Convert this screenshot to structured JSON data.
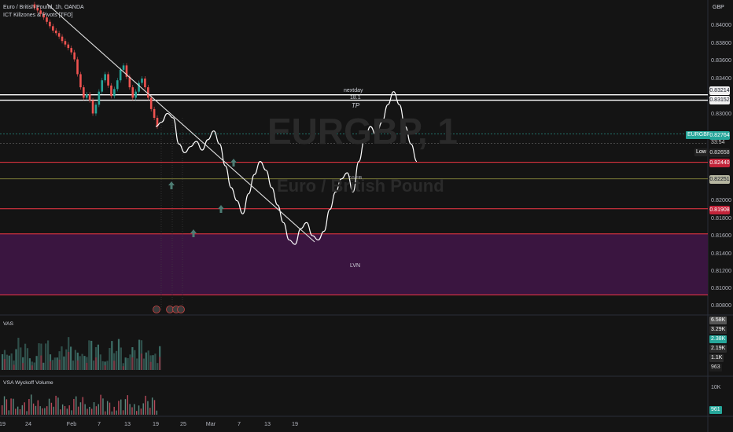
{
  "header": {
    "symbol_line": "Euro / British Pound, 1h, OANDA",
    "indicator_line": "ICT Killzones & Pivots [TFO]"
  },
  "axis": {
    "currency": "GBP",
    "y_ticks": [
      "0.84000",
      "0.83800",
      "0.83600",
      "0.83400",
      "0.83000",
      "0.82000",
      "0.81800",
      "0.81600",
      "0.81400",
      "0.81200",
      "0.81000",
      "0.80800"
    ],
    "x_ticks": [
      "19",
      "24",
      "Feb",
      "7",
      "13",
      "19",
      "25",
      "Mar",
      "7",
      "13",
      "19"
    ]
  },
  "price_labels": {
    "upper1": "0.83214",
    "upper2": "0.83152",
    "symbol": "EURGBP",
    "current": "0.82764",
    "countdown": "33:54",
    "low_label": "Low",
    "low_value": "0.82658",
    "red1": "0.82440",
    "olive": "0.82251",
    "red2": "0.81908"
  },
  "chart_labels": {
    "tp_top": "nextday",
    "tp_mid": "18.1",
    "tp": "TP",
    "fib": "0.5 FIB",
    "lvn": "LVN"
  },
  "watermark": {
    "symbol": "EURGBP, 1",
    "name": "Euro / British Pound"
  },
  "vas": {
    "title": "VAS",
    "badges": [
      "6.58K",
      "3.29K",
      "2.38K",
      "2.19K",
      "1.1K",
      "963"
    ]
  },
  "wyckoff": {
    "title": "VSA Wyckoff Volume",
    "scale": "10K",
    "badge": "961"
  },
  "colors": {
    "background": "#141414",
    "red_level": "#f23645",
    "purple_zone": "#3a1540",
    "white_line": "#ffffff",
    "olive_line": "#8a8a3c",
    "teal_arrow": "#4d7d74",
    "teal_badge": "#26a69a"
  },
  "chart_data": {
    "type": "line",
    "title": "Euro / British Pound, 1h, OANDA",
    "ylabel": "GBP",
    "ylim": [
      0.807,
      0.843
    ],
    "levels": [
      {
        "name": "upper1",
        "value": 0.83214
      },
      {
        "name": "upper2",
        "value": 0.83152
      },
      {
        "name": "current",
        "value": 0.82764
      },
      {
        "name": "low",
        "value": 0.82658
      },
      {
        "name": "red1",
        "value": 0.8244
      },
      {
        "name": "olive",
        "value": 0.82251
      },
      {
        "name": "red2",
        "value": 0.81908
      }
    ],
    "zone": [
      0.8092,
      0.8162
    ],
    "series": [
      {
        "values": [
          0.8425,
          0.8421,
          0.8418,
          0.8414,
          0.841,
          0.8405,
          0.84,
          0.8395,
          0.8392,
          0.8388,
          0.8383,
          0.8379,
          0.8375,
          0.837,
          0.8362,
          0.8345,
          0.833,
          0.8318,
          0.8322,
          0.8315,
          0.83,
          0.831,
          0.8325,
          0.8338,
          0.8345,
          0.8332,
          0.832,
          0.8328,
          0.8338,
          0.835,
          0.8355,
          0.8342,
          0.833,
          0.8318,
          0.8325,
          0.8335,
          0.834,
          0.833,
          0.8318,
          0.8305,
          0.8295,
          0.8285
        ]
      },
      {
        "values": [
          0.8285,
          0.829,
          0.83,
          0.8295,
          0.8265,
          0.8255,
          0.8262,
          0.8268,
          0.8258,
          0.827,
          0.828,
          0.8265,
          0.824,
          0.8215,
          0.82,
          0.8185,
          0.8208,
          0.823,
          0.8245,
          0.8235,
          0.8215,
          0.8195,
          0.8175,
          0.8155,
          0.815,
          0.8168,
          0.8175,
          0.816,
          0.8155,
          0.8165,
          0.819,
          0.821,
          0.8225,
          0.8232,
          0.821,
          0.8245,
          0.827,
          0.8285,
          0.8275,
          0.829,
          0.831,
          0.8325,
          0.831,
          0.8285,
          0.8265,
          0.8245
        ]
      }
    ]
  }
}
